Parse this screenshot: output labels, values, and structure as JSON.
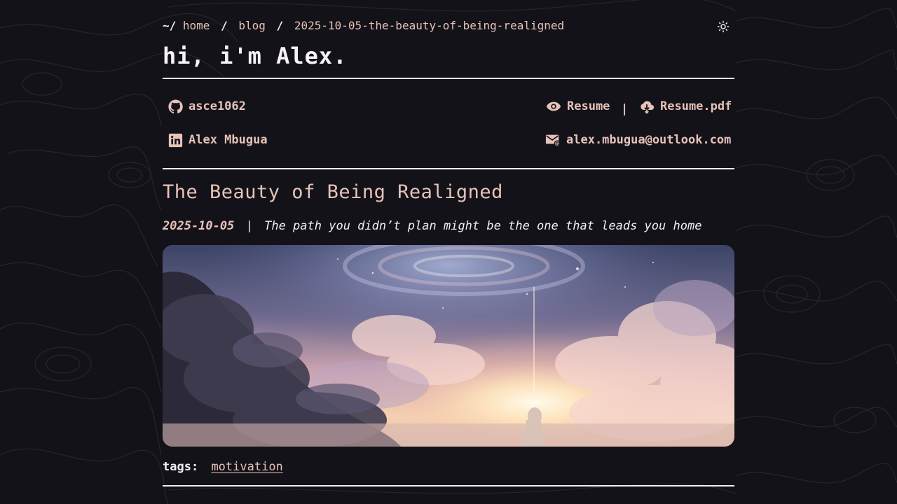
{
  "breadcrumb": {
    "root": "~/",
    "items": [
      "home",
      "blog",
      "2025-10-05-the-beauty-of-being-realigned"
    ],
    "separator": "/"
  },
  "site": {
    "title": "hi, i'm Alex."
  },
  "contacts": {
    "github": "asce1062",
    "linkedin": "Alex Mbugua",
    "resume": "Resume",
    "resume_separator": "|",
    "resume_pdf": "Resume.pdf",
    "email": "alex.mbugua@outlook.com"
  },
  "post": {
    "title": "The Beauty of Being Realigned",
    "date": "2025-10-05",
    "meta_separator": "|",
    "subtitle": "The path you didn’t plan might be the one that leads you home"
  },
  "tags": {
    "label": "tags:",
    "items": [
      "motivation"
    ]
  },
  "icons": {
    "theme": "sun-icon",
    "github": "github-icon",
    "linkedin": "linkedin-icon",
    "resume": "eye-icon",
    "resume_pdf": "cloud-download-icon",
    "email": "mail-icon"
  },
  "colors": {
    "background": "#141219",
    "text": "#f2eef4",
    "accent": "#e6c3b8"
  }
}
